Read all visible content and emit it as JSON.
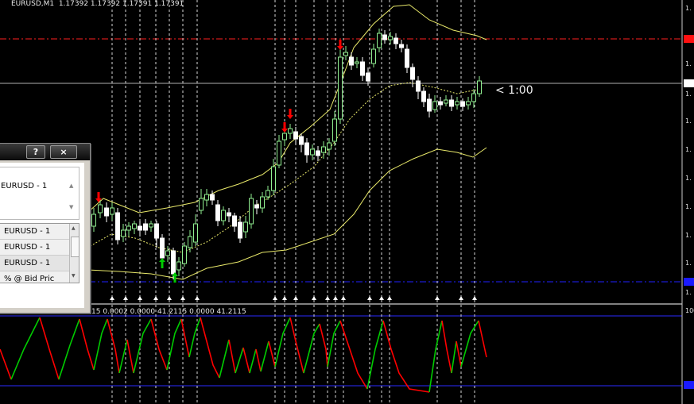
{
  "chart": {
    "title": "EURUSD,M1  1.17392 1.17392 1.17391 1.17391",
    "countdown": "< 1:00",
    "indicator_values": "15 0.0002 0.0000 41.2115 0.0000 41.2115",
    "price_axis_labels": [
      "1.",
      "1.",
      "1.",
      "1.",
      "1.",
      "1.",
      "1.",
      "1.",
      "1.",
      "1.",
      "1.",
      "1."
    ],
    "indicator_axis_top": "100",
    "colors": {
      "background": "#000000",
      "bull_candle": "#90ee90",
      "bear_candle": "#ffffff",
      "bands": "#e8e86a",
      "resistance_line": "#ff0000",
      "support_line": "#0000ff",
      "current_price_line": "#c0c0c0",
      "sell_arrow": "#ff0000",
      "buy_arrow": "#00cc00",
      "oscillator_up": "#00cc00",
      "oscillator_down": "#ff0000",
      "indicator_level": "#0000ff"
    },
    "sell_arrows": 3,
    "buy_arrows": 2
  },
  "dialog": {
    "help_button": "?",
    "close_button": "×",
    "symbol_label": "EURUSD - 1",
    "list_rows": [
      "EURUSD - 1",
      "EURUSD - 1",
      "EURUSD - 1",
      "% @ Bid Pric"
    ],
    "selected_row": 2
  }
}
